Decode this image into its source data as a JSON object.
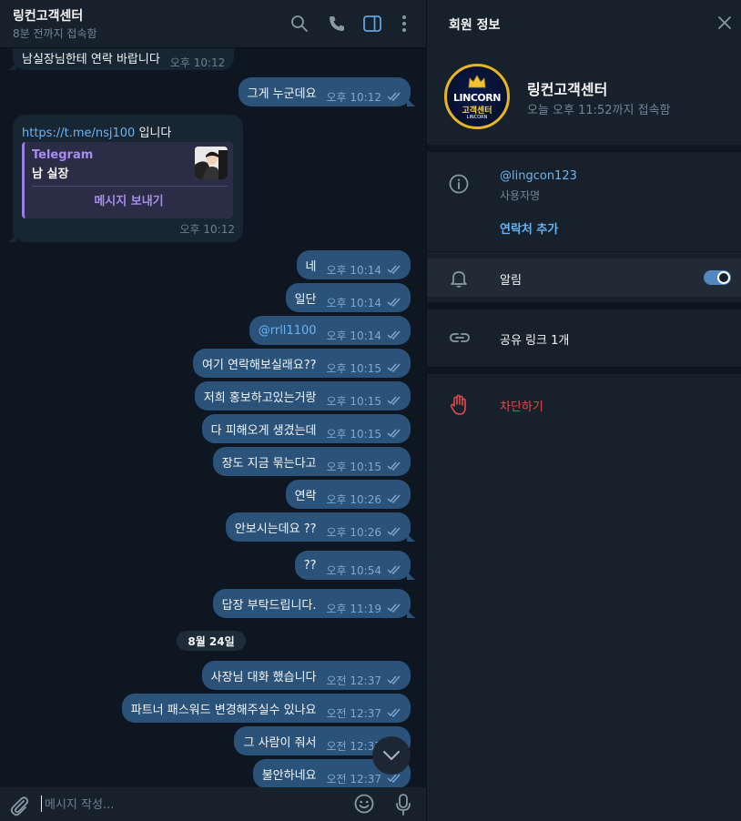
{
  "chat": {
    "title": "링컨고객센터",
    "status": "8분 전까지 접속함"
  },
  "messages": [
    {
      "dir": "in",
      "text": "남실장님한테 연락 바랍니다",
      "time": "오후 10:12"
    },
    {
      "dir": "out",
      "text": "그게 누군데요",
      "time": "오후 10:12"
    },
    {
      "dir": "out",
      "text": "네",
      "time": "오후 10:14"
    },
    {
      "dir": "out",
      "text": "일단",
      "time": "오후 10:14"
    },
    {
      "dir": "out",
      "text": "@rrll1100",
      "time": "오후 10:14"
    },
    {
      "dir": "out",
      "text": "여기 연락해보실래요??",
      "time": "오후 10:15"
    },
    {
      "dir": "out",
      "text": "저희 홍보하고있는거랑",
      "time": "오후 10:15"
    },
    {
      "dir": "out",
      "text": "다 피해오게 생겼는데",
      "time": "오후 10:15"
    },
    {
      "dir": "out",
      "text": "장도 지금 묶는다고",
      "time": "오후 10:15"
    },
    {
      "dir": "out",
      "text": "연락",
      "time": "오후 10:26"
    },
    {
      "dir": "out",
      "text": "안보시는데요 ??",
      "time": "오후 10:26"
    },
    {
      "dir": "out",
      "text": "??",
      "time": "오후 10:54"
    },
    {
      "dir": "out",
      "text": "답장 부탁드립니다.",
      "time": "오후 11:19"
    },
    {
      "dir": "out",
      "text": "사장님 대화 했습니다",
      "time": "오전 12:37"
    },
    {
      "dir": "out",
      "text": "파트너 패스워드 변경해주실수 있나요",
      "time": "오전 12:37"
    },
    {
      "dir": "out",
      "text": "그 사람이 줘서",
      "time": "오전 12:37"
    },
    {
      "dir": "out",
      "text": "불안하네요",
      "time": "오전 12:37"
    }
  ],
  "link_message": {
    "url": "https://t.me/nsj100",
    "suffix": " 입니다",
    "preview_site": "Telegram",
    "preview_title": "남 실장",
    "preview_button": "메시지 보내기",
    "time": "오후 10:12"
  },
  "date_chip": "8월 24일",
  "composer": {
    "placeholder": "메시지 작성..."
  },
  "profile": {
    "heading": "회원 정보",
    "name": "링컨고객센터",
    "last_seen": "오늘 오후 11:52까지 접속함",
    "avatar_brand": "LINCORN",
    "avatar_sub": "고객센터",
    "avatar_tiny": "LINCORN",
    "username": "@lingcon123",
    "username_label": "사용자명",
    "add_contact": "연락처 추가",
    "notifications_label": "알림",
    "notifications_on": true,
    "share_links": "공유 링크 1개",
    "block": "차단하기"
  },
  "colors": {
    "background": "#0e1621",
    "panel": "#17212b",
    "outgoing_bubble": "#2b5278",
    "incoming_bubble": "#182533",
    "accent": "#6ab3f3",
    "danger": "#e5484d",
    "preview_accent": "#a98cf0"
  },
  "icons": [
    "search-icon",
    "phone-icon",
    "sidebar-icon",
    "more-icon",
    "close-icon",
    "info-icon",
    "bell-icon",
    "link-icon",
    "hand-icon",
    "attach-icon",
    "emoji-icon",
    "mic-icon",
    "chevron-down-icon",
    "double-check-icon",
    "crown-icon"
  ]
}
